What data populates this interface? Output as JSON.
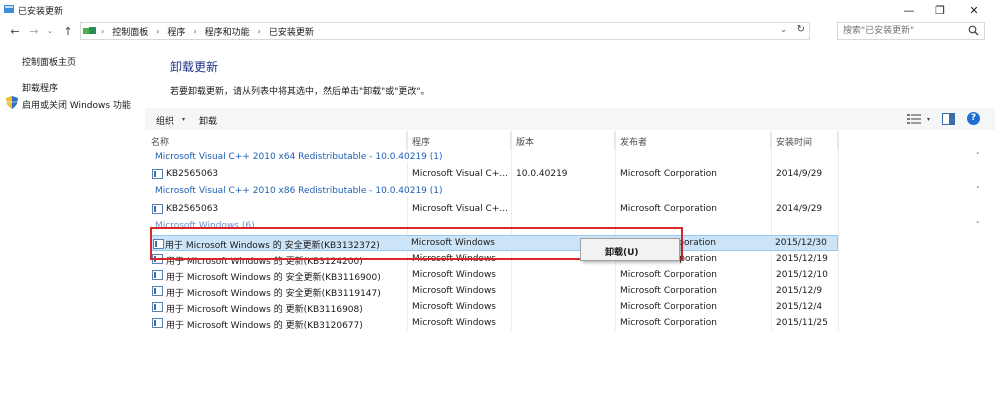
{
  "window": {
    "title": "已安装更新",
    "minimize": "—",
    "maximize": "❐",
    "close": "✕"
  },
  "nav": {
    "back": "←",
    "forward": "→",
    "recent": "⌄",
    "up": "↑",
    "breadcrumbs": [
      "控制面板",
      "程序",
      "程序和功能",
      "已安装更新"
    ],
    "separator": "›",
    "dropdown": "⌄",
    "refresh": "↻",
    "search_placeholder": "搜索\"已安装更新\""
  },
  "sidebar": {
    "home": "控制面板主页",
    "uninstall": "卸载程序",
    "features": "启用或关闭 Windows 功能"
  },
  "main": {
    "heading": "卸载更新",
    "description": "若要卸载更新，请从列表中将其选中，然后单击\"卸载\"或\"更改\"。"
  },
  "toolbar": {
    "organize": "组织",
    "organize_dd": "▾",
    "uninstall": "卸载",
    "view_dd": "▾",
    "help": "?"
  },
  "columns": [
    "名称",
    "程序",
    "版本",
    "发布者",
    "安装时间"
  ],
  "groups": [
    {
      "label": "Microsoft Visual C++ 2010  x64 Redistributable - 10.0.40219 (1)",
      "chevron": "˄",
      "rows": [
        {
          "name": "KB2565063",
          "program": "Microsoft Visual C+...",
          "version": "10.0.40219",
          "publisher": "Microsoft Corporation",
          "date": "2014/9/29"
        }
      ]
    },
    {
      "label": "Microsoft Visual C++ 2010  x86 Redistributable - 10.0.40219 (1)",
      "chevron": "˄",
      "rows": [
        {
          "name": "KB2565063",
          "program": "Microsoft Visual C+...",
          "version": "",
          "publisher": "Microsoft Corporation",
          "date": "2014/9/29"
        }
      ]
    },
    {
      "label": "Microsoft Windows (6)",
      "chevron": "˄",
      "rows": [
        {
          "name": "用于 Microsoft Windows 的 安全更新(KB3132372)",
          "program": "Microsoft Windows",
          "version": "",
          "publisher": "Microsoft Corporation",
          "date": "2015/12/30",
          "selected": true
        },
        {
          "name": "用于 Microsoft Windows 的 更新(KB3124200)",
          "program": "Microsoft Windows",
          "version": "",
          "publisher": "Microsoft Corporation",
          "date": "2015/12/19"
        },
        {
          "name": "用于 Microsoft Windows 的 安全更新(KB3116900)",
          "program": "Microsoft Windows",
          "version": "",
          "publisher": "Microsoft Corporation",
          "date": "2015/12/10"
        },
        {
          "name": "用于 Microsoft Windows 的 安全更新(KB3119147)",
          "program": "Microsoft Windows",
          "version": "",
          "publisher": "Microsoft Corporation",
          "date": "2015/12/9"
        },
        {
          "name": "用于 Microsoft Windows 的 更新(KB3116908)",
          "program": "Microsoft Windows",
          "version": "",
          "publisher": "Microsoft Corporation",
          "date": "2015/12/4"
        },
        {
          "name": "用于 Microsoft Windows 的 更新(KB3120677)",
          "program": "Microsoft Windows",
          "version": "",
          "publisher": "Microsoft Corporation",
          "date": "2015/11/25"
        }
      ]
    }
  ],
  "context_menu": {
    "uninstall": "卸载(U)"
  },
  "colors": {
    "heading": "#1e3287",
    "group_text": "#1e5fb4",
    "selection": "#cce4f7",
    "annotation": "#d9262b",
    "help": "#1e6fd0"
  }
}
